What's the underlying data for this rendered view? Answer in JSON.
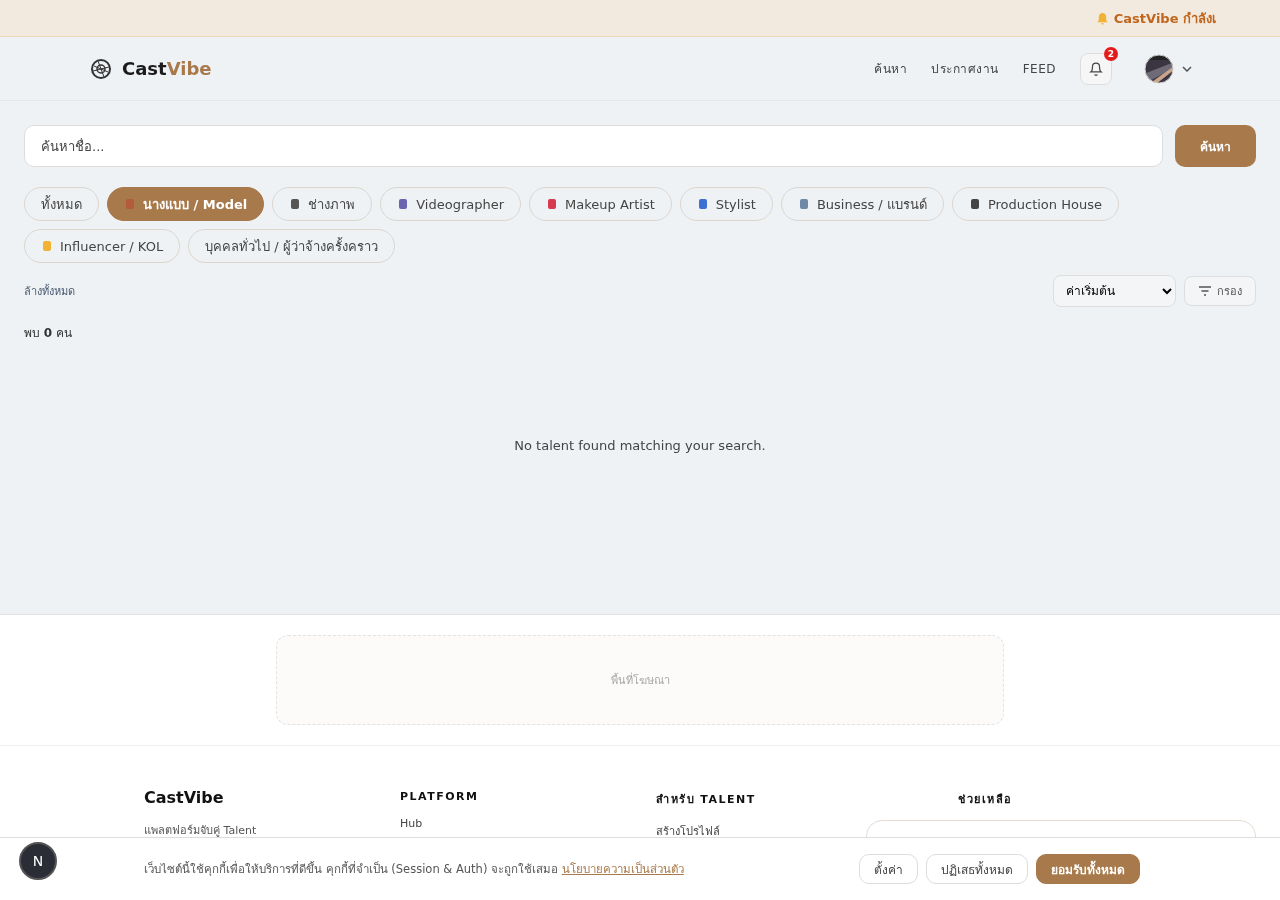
{
  "announcement": {
    "text": "CastVibe กำลังเ"
  },
  "header": {
    "logo_left": "Cast",
    "logo_right": "Vibe",
    "nav": [
      "ค้นหา",
      "ประกาศงาน",
      "FEED"
    ],
    "notification_count": "2"
  },
  "search": {
    "placeholder": "ค้นหาชื่อ...",
    "button": "ค้นหา"
  },
  "categories": [
    {
      "label": "ทั้งหมด",
      "icon": false,
      "selected": false
    },
    {
      "label": "นางแบบ / Model",
      "icon": true,
      "selected": true
    },
    {
      "label": "ช่างภาพ",
      "icon": true,
      "selected": false
    },
    {
      "label": "Videographer",
      "icon": true,
      "selected": false
    },
    {
      "label": "Makeup Artist",
      "icon": true,
      "selected": false
    },
    {
      "label": "Stylist",
      "icon": true,
      "selected": false
    },
    {
      "label": "Business / แบรนด์",
      "icon": true,
      "selected": false
    },
    {
      "label": "Production House",
      "icon": true,
      "selected": false
    },
    {
      "label": "Influencer / KOL",
      "icon": true,
      "selected": false
    },
    {
      "label": "บุคคลทั่วไป / ผู้ว่าจ้างครั้งคราว",
      "icon": false,
      "selected": false
    }
  ],
  "clear_all": "ล้างทั้งหมด",
  "sort": {
    "value": "ค่าเริ่มต้น"
  },
  "filter_button": "กรอง",
  "result_count": "พบ **0** คน",
  "empty_message": "No talent found matching your search.",
  "ad": {
    "label": "พื้นที่โฆษณา"
  },
  "footer": {
    "brand": "CastVibe",
    "tagline": "แพลตฟอร์มจับคู่ Talent",
    "columns": [
      {
        "heading": "PLATFORM",
        "links": [
          "Hub"
        ]
      },
      {
        "heading": "สำหรับ TALENT",
        "links": [
          "สร้างโปรไฟล์"
        ]
      },
      {
        "heading": "ช่วยเหลือ"
      }
    ]
  },
  "cookie": {
    "text": "เว็บไซต์นี้ใช้คุกกี้เพื่อให้บริการที่ดีขึ้น คุกกี้ที่จำเป็น (Session & Auth) จะถูกใช้เสมอ",
    "link": "นโยบายความเป็นส่วนตัว",
    "buttons": [
      {
        "label": "ตั้งค่า",
        "kind": "outline"
      },
      {
        "label": "ปฏิเสธทั้งหมด",
        "kind": "outline"
      },
      {
        "label": "ยอมรับทั้งหมด",
        "kind": "primary"
      }
    ]
  },
  "dev_badge": "N"
}
